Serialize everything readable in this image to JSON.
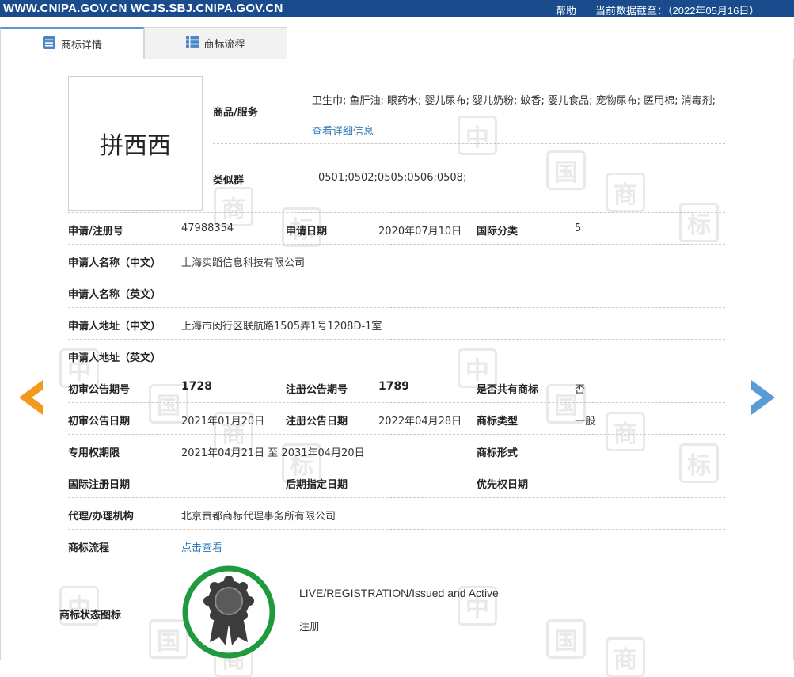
{
  "topbar": {
    "site": "WWW.CNIPA.GOV.CN WCJS.SBJ.CNIPA.GOV.CN",
    "help": "帮助",
    "data_date": "当前数据截至：（2022年05月16日）"
  },
  "tabs": [
    {
      "label": "商标详情",
      "icon": "list-detail-icon",
      "active": true
    },
    {
      "label": "商标流程",
      "icon": "list-flow-icon",
      "active": false
    }
  ],
  "trademark": {
    "name": "拼西西",
    "goods_label": "商品/服务",
    "goods": "卫生巾; 鱼肝油; 眼药水; 婴儿尿布; 婴儿奶粉; 蚊香; 婴儿食品; 宠物尿布; 医用棉; 消毒剂;",
    "goods_link": "查看详细信息",
    "similar_label": "类似群",
    "similar": "0501;0502;0505;0506;0508;"
  },
  "fields": {
    "reg_no_label": "申请/注册号",
    "reg_no": "47988354",
    "apply_date_label": "申请日期",
    "apply_date": "2020年07月10日",
    "intl_class_label": "国际分类",
    "intl_class": "5",
    "applicant_cn_label": "申请人名称（中文）",
    "applicant_cn": "上海实蹈信息科技有限公司",
    "applicant_en_label": "申请人名称（英文）",
    "address_cn_label": "申请人地址（中文）",
    "address_cn": "上海市闵行区联航路1505弄1号1208D-1室",
    "address_en_label": "申请人地址（英文）",
    "prelim_no_label": "初审公告期号",
    "prelim_no": "1728",
    "reg_ann_no_label": "注册公告期号",
    "reg_ann_no": "1789",
    "shared_label": "是否共有商标",
    "shared": "否",
    "prelim_date_label": "初审公告日期",
    "prelim_date": "2021年01月20日",
    "reg_ann_date_label": "注册公告日期",
    "reg_ann_date": "2022年04月28日",
    "tm_type_label": "商标类型",
    "tm_type": "一般",
    "exclusive_label": "专用权期限",
    "exclusive": "2021年04月21日 至 2031年04月20日",
    "tm_form_label": "商标形式",
    "intl_reg_date_label": "国际注册日期",
    "later_date_label": "后期指定日期",
    "priority_label": "优先权日期",
    "agency_label": "代理/办理机构",
    "agency": "北京贵都商标代理事务所有限公司",
    "flow_label": "商标流程",
    "flow_link": "点击查看",
    "status_icon_label": "商标状态图标",
    "status_en": "LIVE/REGISTRATION/Issued and Active",
    "status_cn": "注册"
  },
  "watermark": {
    "chars": [
      "中",
      "国",
      "商",
      "标"
    ]
  },
  "colors": {
    "topbar": "#1a4b8c",
    "link": "#2e7ab8",
    "prev_arrow": "#f39a1e",
    "next_arrow": "#5b9bd5",
    "badge_ring": "#1f9a3e"
  }
}
